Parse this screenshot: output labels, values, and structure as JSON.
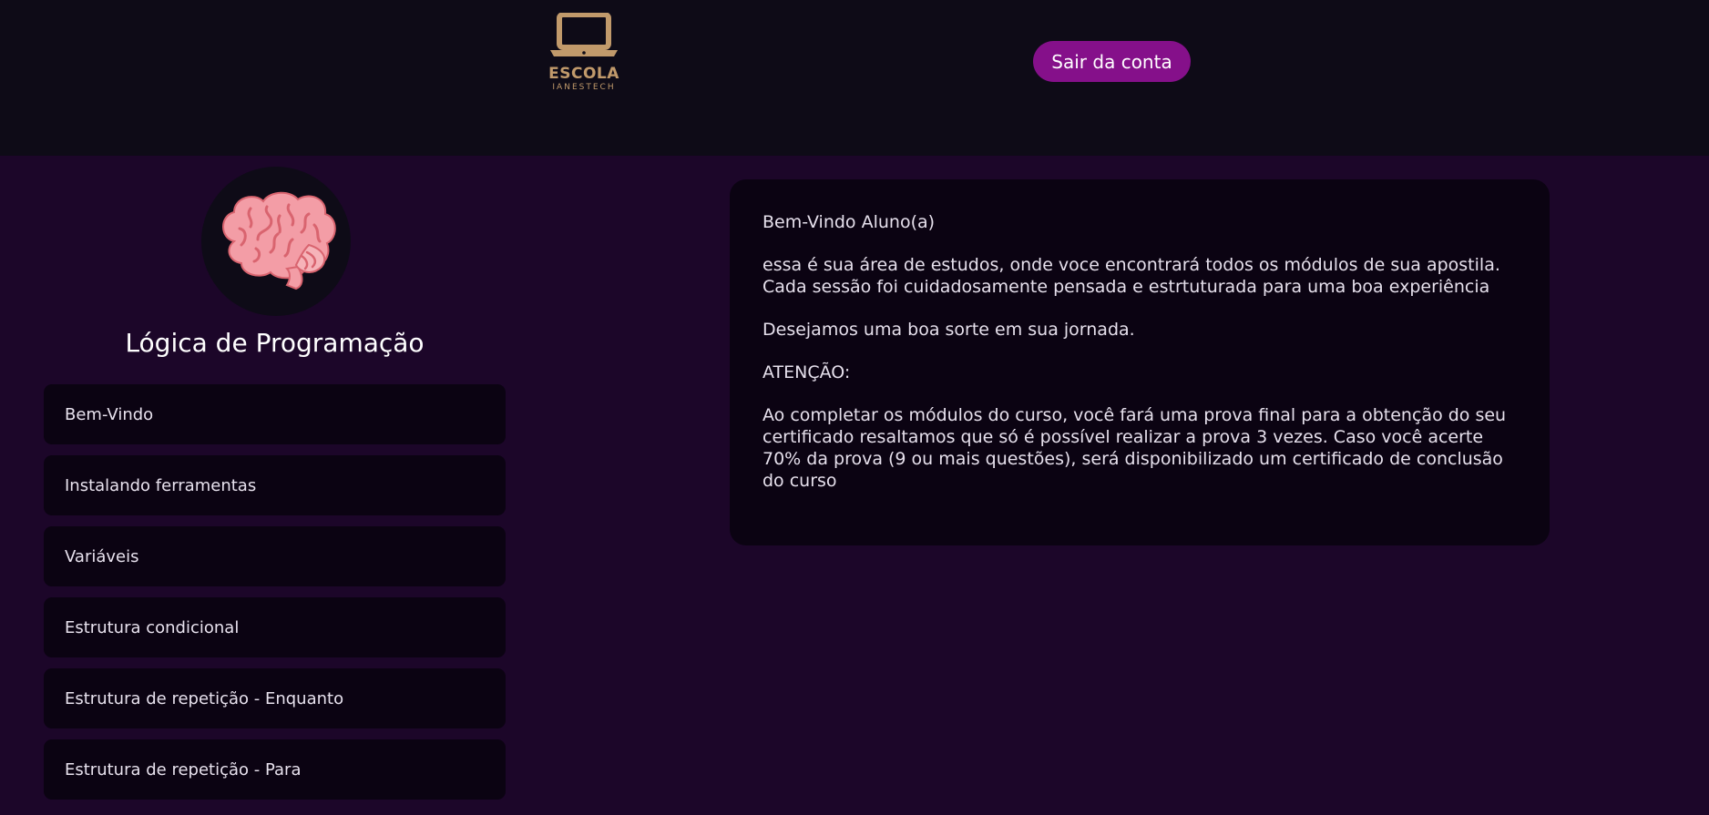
{
  "header": {
    "logo": {
      "icon": "laptop-icon",
      "title": "ESCOLA",
      "subtitle": "IANESTECH",
      "color": "#c19a6b"
    },
    "logout_label": "Sair da conta",
    "logout_color": "#85108a"
  },
  "sidebar": {
    "course_icon": "brain-icon",
    "course_title": "Lógica de Programação",
    "modules": [
      {
        "label": "Bem-Vindo"
      },
      {
        "label": "Instalando ferramentas"
      },
      {
        "label": "Variáveis"
      },
      {
        "label": "Estrutura condicional"
      },
      {
        "label": "Estrutura de repetição - Enquanto"
      },
      {
        "label": "Estrutura de repetição - Para"
      }
    ]
  },
  "main": {
    "greeting": "Bem-Vindo Aluno(a)",
    "intro": "essa é sua área de estudos, onde voce encontrará todos os módulos de sua apostila.\nCada sessão foi cuidadosamente pensada e estrtuturada para uma boa experiência",
    "wish": "Desejamos uma boa sorte em sua jornada.",
    "attention_label": "ATENÇÃO:",
    "attention_text": "Ao completar os módulos do curso, você fará uma prova final para a obtenção do seu certificado resaltamos que só é possível realizar a prova 3 vezes. Caso você acerte 70% da prova (9 ou mais questões), será disponibilizado um certificado de conclusão do curso"
  },
  "colors": {
    "page_background": "#1c0629",
    "header_background": "#0e0b17",
    "card_background": "#0b0312"
  }
}
